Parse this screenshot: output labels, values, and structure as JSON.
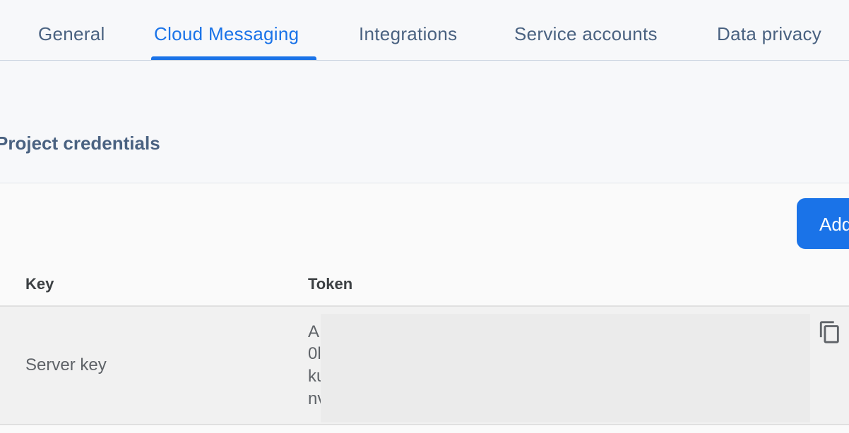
{
  "tabs": [
    {
      "label": "General"
    },
    {
      "label": "Cloud Messaging",
      "active": true
    },
    {
      "label": "Integrations"
    },
    {
      "label": "Service accounts"
    },
    {
      "label": "Data privacy"
    }
  ],
  "section": {
    "title": "Project credentials"
  },
  "card": {
    "add_button_label": "Add",
    "columns": {
      "key": "Key",
      "token": "Token"
    },
    "rows": [
      {
        "key": "Server key",
        "token_lines": [
          "A",
          "0l",
          "ku",
          "nv"
        ],
        "copy_icon": "copy-icon"
      }
    ]
  },
  "colors": {
    "accent": "#1a73e8",
    "tab_text": "#4a6281",
    "background": "#f7f8fa",
    "card": "#fafafa",
    "row": "#f1f1f1"
  }
}
